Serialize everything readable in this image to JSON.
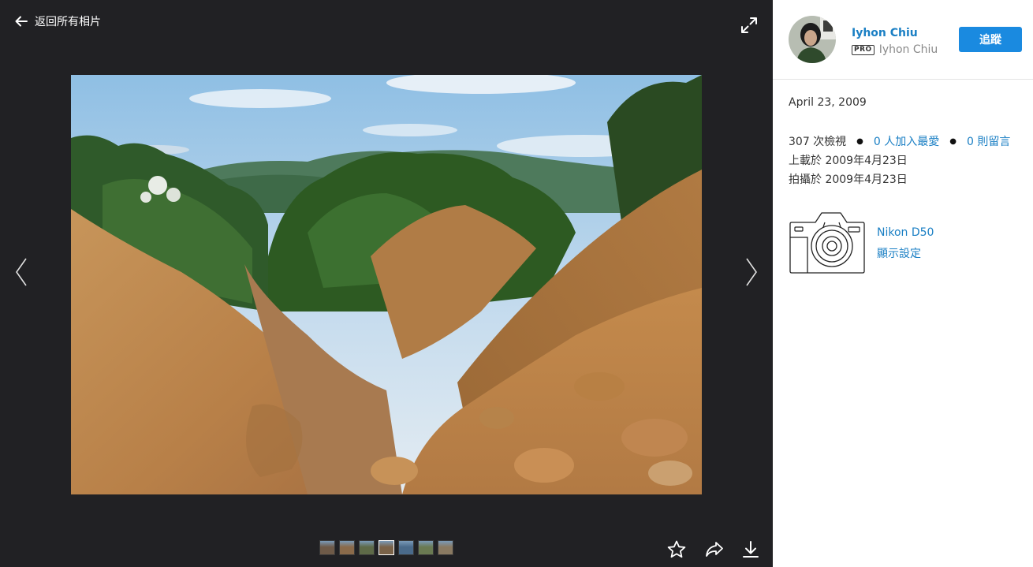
{
  "viewer": {
    "back_label": "返回所有相片",
    "icons": {
      "back": "arrow-left-icon",
      "expand": "expand-icon",
      "prev": "chevron-left-icon",
      "next": "chevron-right-icon",
      "favorite": "star-icon",
      "share": "share-icon",
      "download": "download-icon"
    },
    "filmstrip": [
      {
        "active": false,
        "color": "#6e5a48"
      },
      {
        "active": false,
        "color": "#8a6a4a"
      },
      {
        "active": false,
        "color": "#5e6a48"
      },
      {
        "active": true,
        "color": "#7a6248"
      },
      {
        "active": false,
        "color": "#4a6a8a"
      },
      {
        "active": false,
        "color": "#6a7a52"
      },
      {
        "active": false,
        "color": "#8a7a62"
      }
    ]
  },
  "author": {
    "name": "Iyhon Chiu",
    "pro_badge": "PRO",
    "username": "Iyhon Chiu",
    "follow_label": "追蹤"
  },
  "photo": {
    "date": "April 23, 2009",
    "views": "307 次檢視",
    "faves": "0 人加入最愛",
    "comments": "0 則留言",
    "uploaded": "上載於 2009年4月23日",
    "taken": "拍攝於 2009年4月23日"
  },
  "camera": {
    "model": "Nikon D50",
    "exif_label": "顯示設定"
  },
  "colors": {
    "viewer_bg": "#212124",
    "link": "#1a7fc4",
    "follow_button": "#1a8ae0"
  }
}
